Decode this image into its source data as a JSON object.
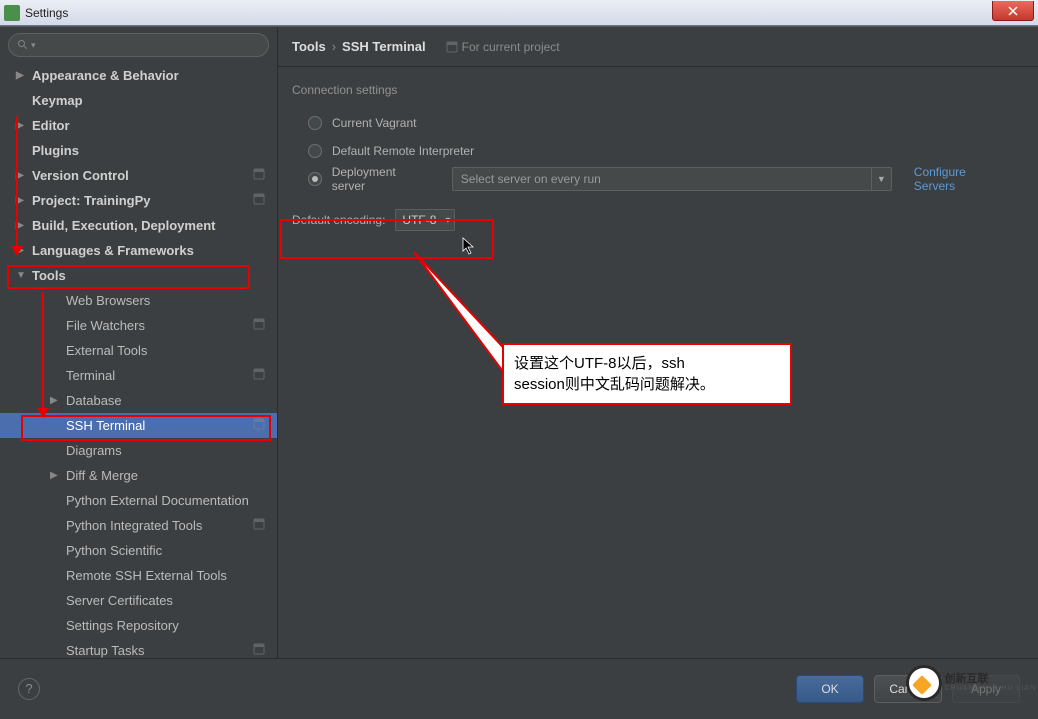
{
  "window": {
    "title": "Settings"
  },
  "sidebar": {
    "items": [
      {
        "label": "Appearance & Behavior",
        "level": 1,
        "arrow": "collapsed"
      },
      {
        "label": "Keymap",
        "level": 1,
        "arrow": "none"
      },
      {
        "label": "Editor",
        "level": 1,
        "arrow": "collapsed"
      },
      {
        "label": "Plugins",
        "level": 1,
        "arrow": "none"
      },
      {
        "label": "Version Control",
        "level": 1,
        "arrow": "collapsed",
        "proj": true
      },
      {
        "label": "Project: TrainingPy",
        "level": 1,
        "arrow": "collapsed",
        "proj": true
      },
      {
        "label": "Build, Execution, Deployment",
        "level": 1,
        "arrow": "collapsed"
      },
      {
        "label": "Languages & Frameworks",
        "level": 1,
        "arrow": "collapsed"
      },
      {
        "label": "Tools",
        "level": 1,
        "arrow": "expanded"
      },
      {
        "label": "Web Browsers",
        "level": 2,
        "arrow": "none"
      },
      {
        "label": "File Watchers",
        "level": 2,
        "arrow": "none",
        "proj": true
      },
      {
        "label": "External Tools",
        "level": 2,
        "arrow": "none"
      },
      {
        "label": "Terminal",
        "level": 2,
        "arrow": "none",
        "proj": true
      },
      {
        "label": "Database",
        "level": 2,
        "arrow": "collapsed"
      },
      {
        "label": "SSH Terminal",
        "level": 2,
        "arrow": "none",
        "selected": true,
        "proj": true
      },
      {
        "label": "Diagrams",
        "level": 2,
        "arrow": "none"
      },
      {
        "label": "Diff & Merge",
        "level": 2,
        "arrow": "collapsed"
      },
      {
        "label": "Python External Documentation",
        "level": 2,
        "arrow": "none"
      },
      {
        "label": "Python Integrated Tools",
        "level": 2,
        "arrow": "none",
        "proj": true
      },
      {
        "label": "Python Scientific",
        "level": 2,
        "arrow": "none"
      },
      {
        "label": "Remote SSH External Tools",
        "level": 2,
        "arrow": "none"
      },
      {
        "label": "Server Certificates",
        "level": 2,
        "arrow": "none"
      },
      {
        "label": "Settings Repository",
        "level": 2,
        "arrow": "none"
      },
      {
        "label": "Startup Tasks",
        "level": 2,
        "arrow": "none",
        "proj": true
      }
    ]
  },
  "breadcrumb": {
    "root": "Tools",
    "leaf": "SSH Terminal",
    "project_scope": "For current project"
  },
  "content": {
    "section_title": "Connection settings",
    "radios": {
      "r1": "Current Vagrant",
      "r2": "Default Remote Interpreter",
      "r3": "Deployment server"
    },
    "server_placeholder": "Select server on every run",
    "configure_link": "Configure Servers",
    "encoding_label": "Default encoding:",
    "encoding_value": "UTF-8"
  },
  "annotation": {
    "text_line1": "设置这个UTF-8以后，ssh",
    "text_line2": "session则中文乱码问题解决。"
  },
  "buttons": {
    "ok": "OK",
    "cancel": "Cancel",
    "apply": "Apply"
  },
  "watermark": {
    "brand": "创新互联",
    "sub": "CHUANG XIN HU LIAN"
  }
}
